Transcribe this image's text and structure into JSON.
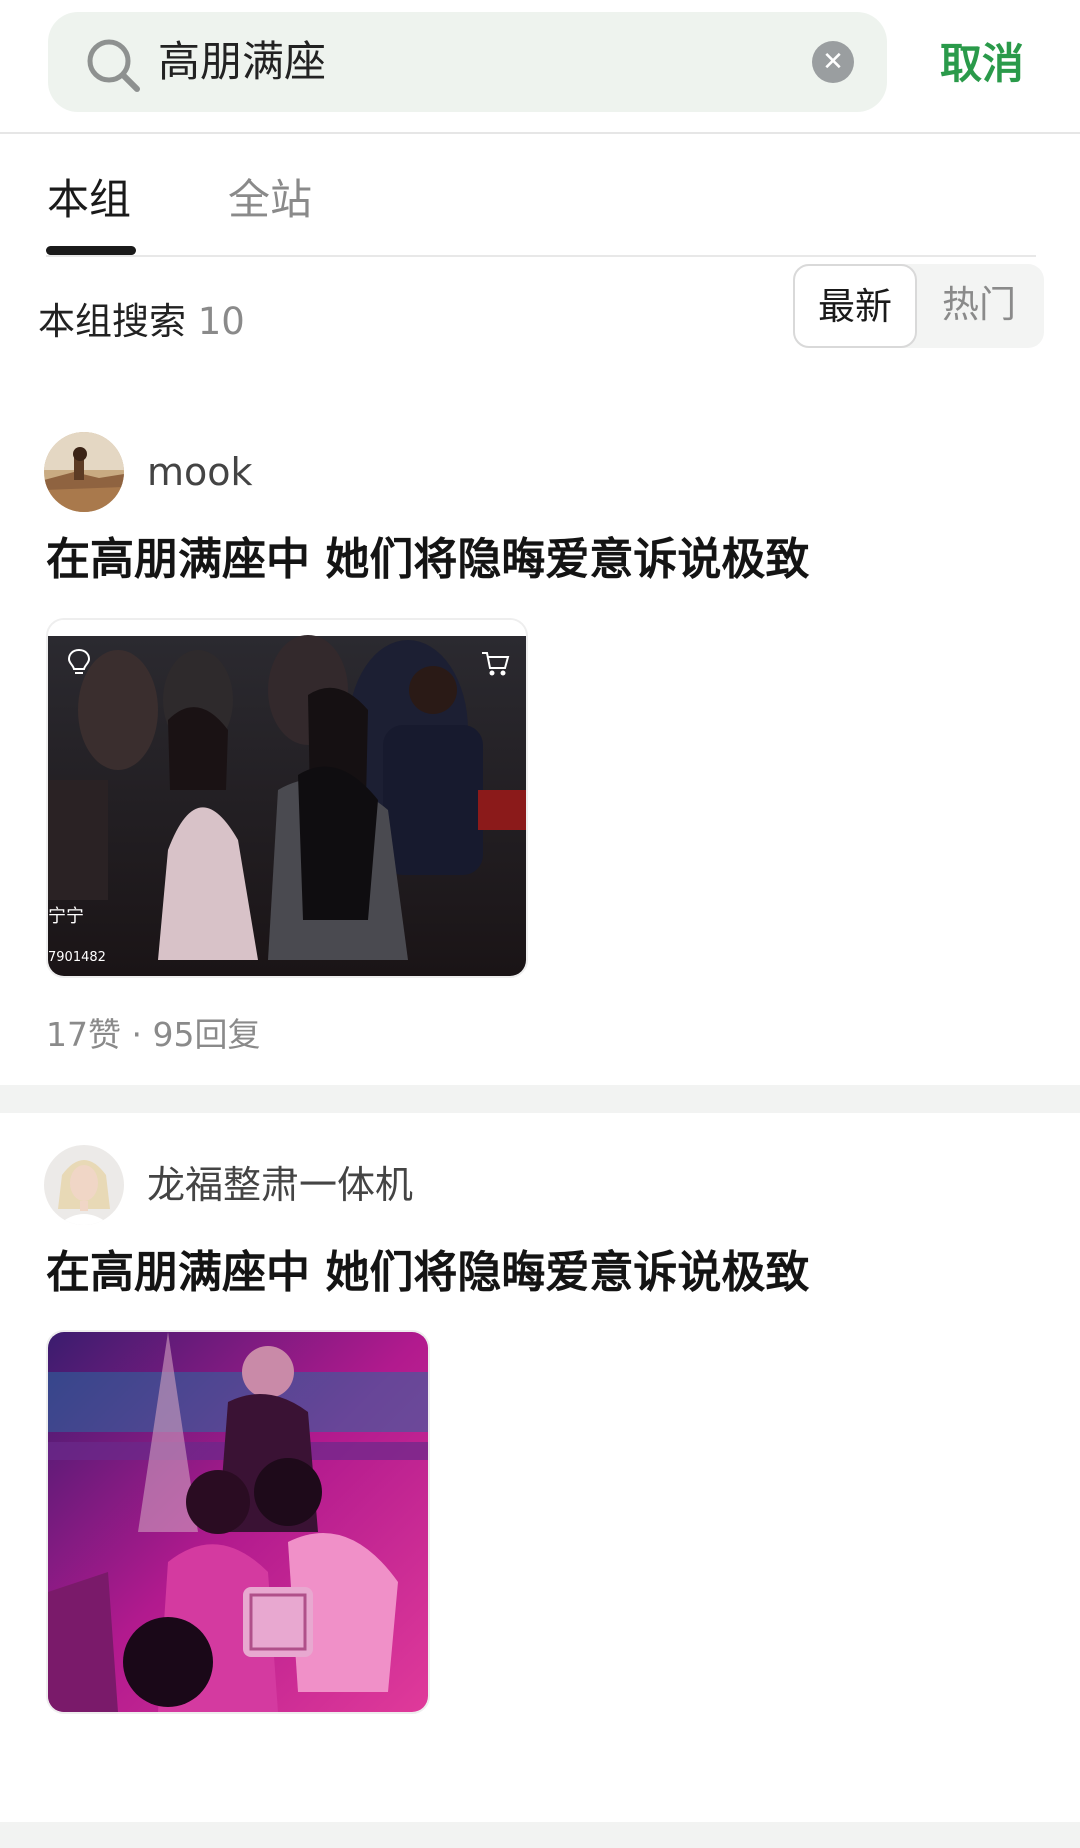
{
  "search": {
    "query": "高朋满座",
    "cancel_label": "取消"
  },
  "tabs": [
    {
      "label": "本组"
    },
    {
      "label": "全站"
    }
  ],
  "results": {
    "label": "本组搜索",
    "count": "10"
  },
  "sort": {
    "latest": "最新",
    "hot": "热门"
  },
  "posts": [
    {
      "author": "mook",
      "title": "在高朋满座中 她们将隐晦爱意诉说极致",
      "image_caption_name": "宁宁",
      "image_caption_id": "7901482",
      "stats": "17赞 · 95回复"
    },
    {
      "author": "龙福整肃一体机",
      "title": "在高朋满座中 她们将隐晦爱意诉说极致",
      "stats": ""
    }
  ],
  "colors": {
    "accent": "#2a9a4a",
    "search_bg": "#eef3ee"
  },
  "icons": [
    "search-icon",
    "close-icon",
    "lightbulb-icon",
    "cart-icon"
  ]
}
